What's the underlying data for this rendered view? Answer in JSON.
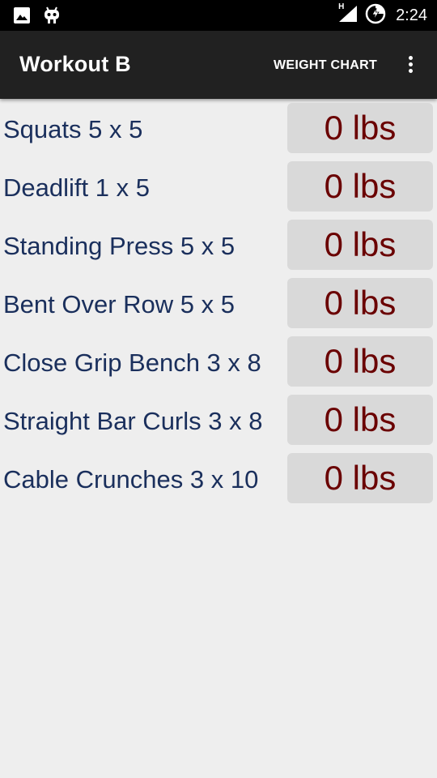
{
  "status_bar": {
    "time": "2:24",
    "network_type": "H",
    "icons": [
      "image-icon",
      "android-debug-icon",
      "signal-icon",
      "battery-charging-icon"
    ]
  },
  "app_bar": {
    "title": "Workout B",
    "action_label": "WEIGHT CHART",
    "overflow_icon": "more-vert-icon"
  },
  "exercises": [
    {
      "name": "Squats 5 x 5",
      "weight": "0 lbs"
    },
    {
      "name": "Deadlift 1 x 5",
      "weight": "0 lbs"
    },
    {
      "name": "Standing Press 5 x 5",
      "weight": "0 lbs"
    },
    {
      "name": "Bent Over Row 5 x 5",
      "weight": "0 lbs"
    },
    {
      "name": "Close Grip Bench 3 x 8",
      "weight": "0 lbs"
    },
    {
      "name": "Straight Bar Curls 3 x 8",
      "weight": "0 lbs"
    },
    {
      "name": "Cable Crunches 3 x 10",
      "weight": "0 lbs"
    }
  ],
  "colors": {
    "app_bar": "#212121",
    "label_text": "#1a2f5c",
    "weight_text": "#6a0000",
    "weight_button": "#d9d9d9",
    "background": "#eeeeee"
  }
}
